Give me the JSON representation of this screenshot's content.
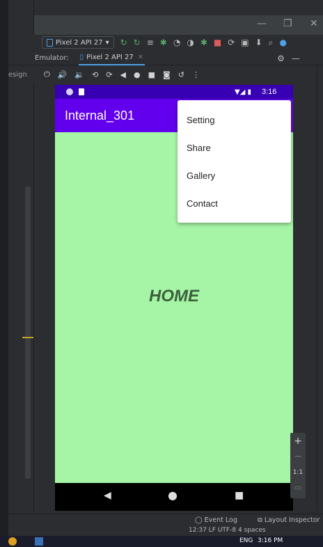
{
  "ide": {
    "device_selector": "Pixel 2 API 27",
    "emulator_label": "Emulator:",
    "emulator_tab": "Pixel 2 API 27",
    "design_label": "esign"
  },
  "phone": {
    "status_time": "3:16",
    "app_title": "Internal_301",
    "home_text": "HOME"
  },
  "menu": {
    "items": [
      "Setting",
      "Share",
      "Gallery",
      "Contact"
    ]
  },
  "zoom": {
    "plus": "+",
    "minus": "−",
    "ratio": "1:1"
  },
  "status_bar": {
    "event_log": "Event Log",
    "layout_inspector": "Layout Inspector",
    "position": "12:37  LF  UTF-8  4 spaces"
  },
  "taskbar": {
    "lang": "ENG",
    "time": "3:16 PM"
  }
}
